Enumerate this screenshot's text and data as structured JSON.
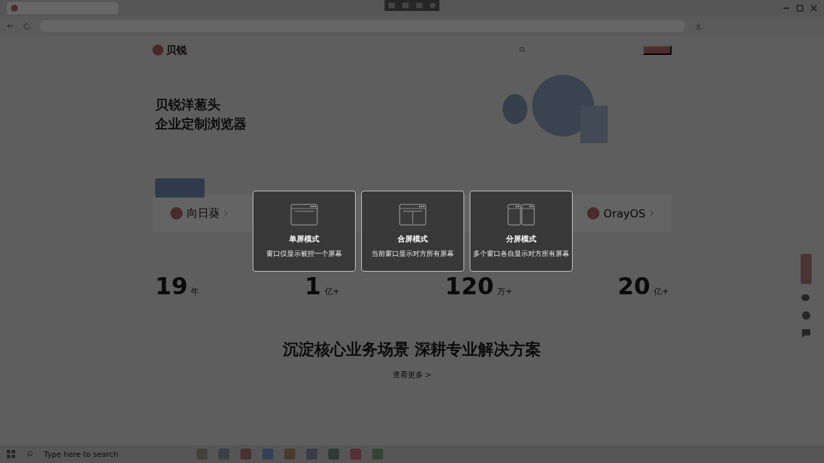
{
  "site": {
    "logo": "贝锐"
  },
  "hero": {
    "title_lines": [
      "贝锐洋葱头",
      "企业定制浏览器"
    ]
  },
  "products": [
    {
      "name": "向日葵"
    },
    {
      "name": "OrayOS"
    }
  ],
  "stats": [
    {
      "value": "19",
      "unit": "年"
    },
    {
      "value": "1",
      "unit": "亿+"
    },
    {
      "value": "120",
      "unit": "万+"
    },
    {
      "value": "20",
      "unit": "亿+"
    }
  ],
  "section": {
    "title": "沉淀核心业务场景 深耕专业解决方案",
    "more": "查看更多 >"
  },
  "modes": [
    {
      "kind": "single",
      "title": "单屏模式",
      "description": "窗口仅显示被控一个屏幕"
    },
    {
      "kind": "merged",
      "title": "合屏模式",
      "description": "当前窗口显示对方所有屏幕"
    },
    {
      "kind": "split",
      "title": "分屏模式",
      "description": "多个窗口各自显示对方所有屏幕"
    }
  ],
  "taskbar": {
    "search_placeholder": "Type here to search"
  }
}
